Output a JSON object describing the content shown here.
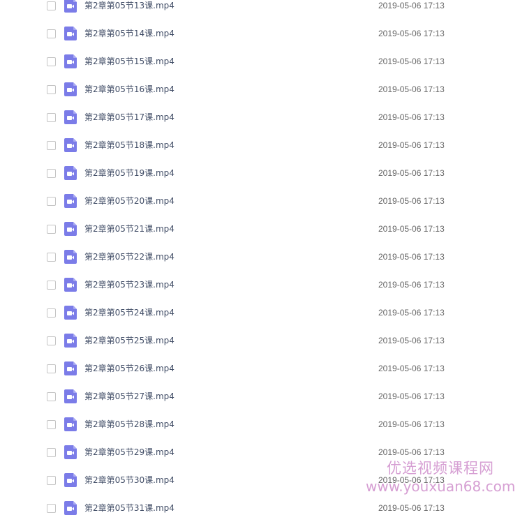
{
  "colors": {
    "video_icon": "#7b7ce8",
    "file_name_text": "#424e67",
    "date_text": "#666666",
    "checkbox_border": "#c4c4c4",
    "watermark": "#b450af"
  },
  "icons": {
    "row_checkbox": "checkbox-unchecked",
    "file_type": "video-file-icon"
  },
  "files": [
    {
      "name": "第2章第05节13课.mp4",
      "date": "2019-05-06 17:13"
    },
    {
      "name": "第2章第05节14课.mp4",
      "date": "2019-05-06 17:13"
    },
    {
      "name": "第2章第05节15课.mp4",
      "date": "2019-05-06 17:13"
    },
    {
      "name": "第2章第05节16课.mp4",
      "date": "2019-05-06 17:13"
    },
    {
      "name": "第2章第05节17课.mp4",
      "date": "2019-05-06 17:13"
    },
    {
      "name": "第2章第05节18课.mp4",
      "date": "2019-05-06 17:13"
    },
    {
      "name": "第2章第05节19课.mp4",
      "date": "2019-05-06 17:13"
    },
    {
      "name": "第2章第05节20课.mp4",
      "date": "2019-05-06 17:13"
    },
    {
      "name": "第2章第05节21课.mp4",
      "date": "2019-05-06 17:13"
    },
    {
      "name": "第2章第05节22课.mp4",
      "date": "2019-05-06 17:13"
    },
    {
      "name": "第2章第05节23课.mp4",
      "date": "2019-05-06 17:13"
    },
    {
      "name": "第2章第05节24课.mp4",
      "date": "2019-05-06 17:13"
    },
    {
      "name": "第2章第05节25课.mp4",
      "date": "2019-05-06 17:13"
    },
    {
      "name": "第2章第05节26课.mp4",
      "date": "2019-05-06 17:13"
    },
    {
      "name": "第2章第05节27课.mp4",
      "date": "2019-05-06 17:13"
    },
    {
      "name": "第2章第05节28课.mp4",
      "date": "2019-05-06 17:13"
    },
    {
      "name": "第2章第05节29课.mp4",
      "date": "2019-05-06 17:13"
    },
    {
      "name": "第2章第05节30课.mp4",
      "date": "2019-05-06 17:13"
    },
    {
      "name": "第2章第05节31课.mp4",
      "date": "2019-05-06 17:13"
    }
  ],
  "watermark": {
    "title": "优选视频课程网",
    "url": "www.youxuan68.com"
  }
}
